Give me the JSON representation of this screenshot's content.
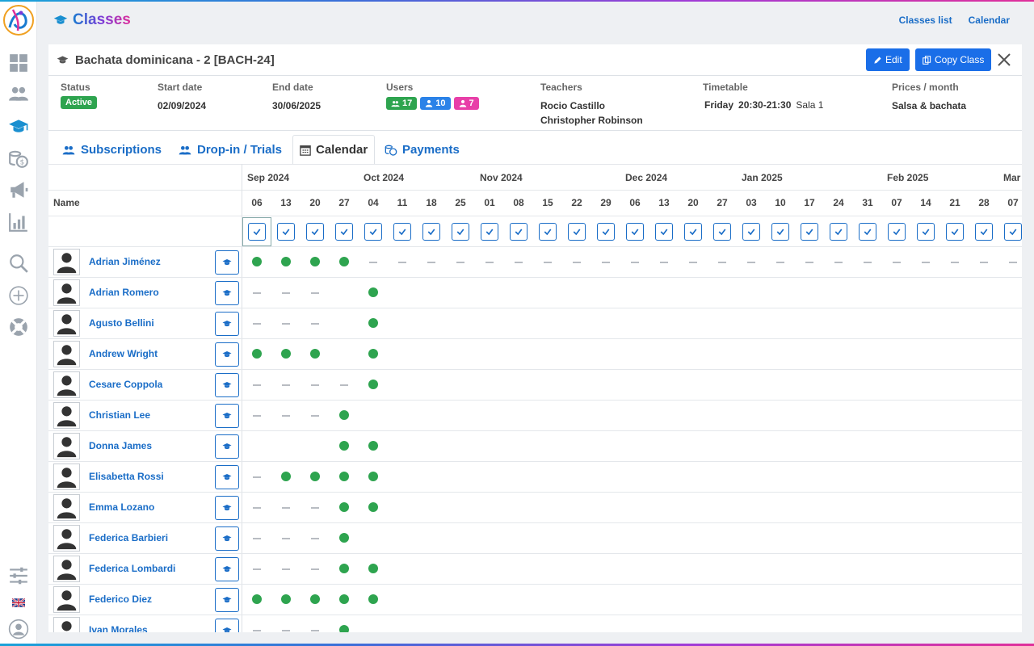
{
  "app": {
    "title": "Classes"
  },
  "top_links": [
    "Classes list",
    "Calendar"
  ],
  "class": {
    "title": "Bachata dominicana - 2 [BACH-24]",
    "edit_label": "Edit",
    "copy_label": "Copy Class"
  },
  "info": {
    "status_label": "Status",
    "status_value": "Active",
    "start_label": "Start date",
    "start_value": "02/09/2024",
    "end_label": "End date",
    "end_value": "30/06/2025",
    "users_label": "Users",
    "users_total": "17",
    "users_male": "10",
    "users_female": "7",
    "teachers_label": "Teachers",
    "teacher_1": "Rocio Castillo",
    "teacher_2": "Christopher Robinson",
    "timetable_label": "Timetable",
    "timetable_day": "Friday",
    "timetable_time": "20:30-21:30",
    "timetable_room": "Sala 1",
    "prices_label": "Prices / month",
    "prices_value": "Salsa & bachata"
  },
  "tabs": [
    {
      "label": "Subscriptions"
    },
    {
      "label": "Drop-in / Trials"
    },
    {
      "label": "Calendar"
    },
    {
      "label": "Payments"
    }
  ],
  "calendar": {
    "name_header": "Name",
    "months": [
      {
        "label": "Sep 2024",
        "col": 0
      },
      {
        "label": "Oct 2024",
        "col": 4
      },
      {
        "label": "Nov 2024",
        "col": 8
      },
      {
        "label": "Dec 2024",
        "col": 13
      },
      {
        "label": "Jan 2025",
        "col": 17
      },
      {
        "label": "Feb 2025",
        "col": 22
      },
      {
        "label": "Mar",
        "col": 26
      }
    ],
    "days": [
      "06",
      "13",
      "20",
      "27",
      "04",
      "11",
      "18",
      "25",
      "01",
      "08",
      "15",
      "22",
      "29",
      "06",
      "13",
      "20",
      "27",
      "03",
      "10",
      "17",
      "24",
      "31",
      "07",
      "14",
      "21",
      "28",
      "07"
    ],
    "students": [
      {
        "name": "Adrian Jiménez",
        "att": [
          "p",
          "p",
          "p",
          "p",
          "a",
          "a",
          "a",
          "a",
          "a",
          "a",
          "a",
          "a",
          "a",
          "a",
          "a",
          "a",
          "a",
          "a",
          "a",
          "a",
          "a",
          "a",
          "a",
          "a",
          "a",
          "a",
          "a"
        ]
      },
      {
        "name": "Adrian Romero",
        "att": [
          "a",
          "a",
          "a",
          "",
          "p"
        ]
      },
      {
        "name": "Agusto Bellini",
        "att": [
          "a",
          "a",
          "a",
          "",
          "p"
        ]
      },
      {
        "name": "Andrew Wright",
        "att": [
          "p",
          "p",
          "p",
          "",
          "p"
        ]
      },
      {
        "name": "Cesare Coppola",
        "att": [
          "a",
          "a",
          "a",
          "a",
          "p"
        ]
      },
      {
        "name": "Christian Lee",
        "att": [
          "a",
          "a",
          "a",
          "p",
          ""
        ]
      },
      {
        "name": "Donna James",
        "att": [
          "",
          "",
          "",
          "p",
          "p"
        ]
      },
      {
        "name": "Elisabetta Rossi",
        "att": [
          "a",
          "p",
          "p",
          "p",
          "p"
        ]
      },
      {
        "name": "Emma Lozano",
        "att": [
          "a",
          "a",
          "a",
          "p",
          "p"
        ]
      },
      {
        "name": "Federica Barbieri",
        "att": [
          "a",
          "a",
          "a",
          "p",
          ""
        ]
      },
      {
        "name": "Federica Lombardi",
        "att": [
          "a",
          "a",
          "a",
          "p",
          "p"
        ]
      },
      {
        "name": "Federico Diez",
        "att": [
          "p",
          "p",
          "p",
          "p",
          "p"
        ]
      },
      {
        "name": "Ivan Morales",
        "att": [
          "a",
          "a",
          "a",
          "p",
          ""
        ]
      }
    ]
  },
  "colors": {
    "accent": "#1a6ee8",
    "present": "#2ea44f",
    "female": "#e83fa8"
  },
  "icons": [
    "dashboard-icon",
    "users-icon",
    "graduation-cap-icon",
    "coins-icon",
    "megaphone-icon",
    "chart-icon",
    "search-icon",
    "plus-circle-icon",
    "lifebuoy-icon",
    "sliders-icon",
    "flag-uk-icon",
    "user-circle-icon"
  ]
}
